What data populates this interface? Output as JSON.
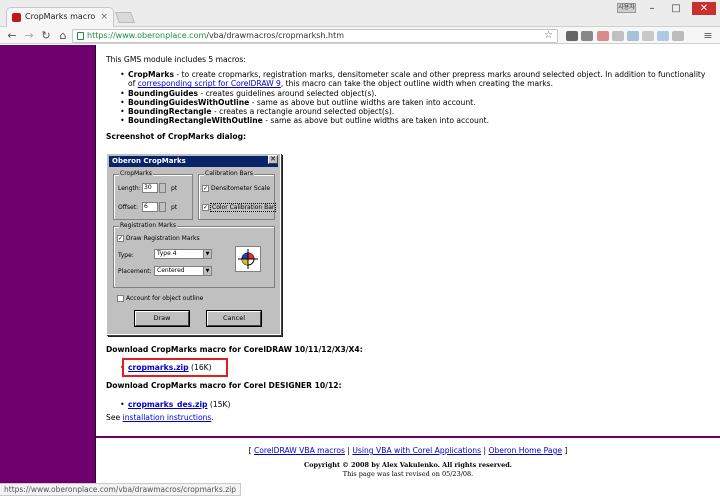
{
  "browser": {
    "tab_title": "CropMarks macro",
    "tab_close": "×",
    "url_host": "https://www.oberonplace.com",
    "url_path": "/vba/drawmacros/cropmarksh.htm",
    "back_icon": "back-arrow-icon",
    "forward_icon": "forward-arrow-icon",
    "reload_icon": "reload-icon",
    "home_icon": "home-icon",
    "user_label": "사용자",
    "window_controls": {
      "minimize": "–",
      "maximize": "□",
      "close": "✕"
    },
    "star": "☆"
  },
  "page": {
    "intro": "This GMS module includes 5 macros:",
    "macros": [
      {
        "name": "CropMarks",
        "text_a": " - to create cropmarks, registration marks, densitometer scale and other prepress marks around selected object. In addition to functionality of ",
        "link": "corresponding script for CorelDRAW 9",
        "text_b": ", this macro can take the object outline width when creating the marks."
      },
      {
        "name": "BoundingGuides",
        "text": " - creates guidelines around selected object(s)."
      },
      {
        "name": "BoundingGuidesWithOutline",
        "text": " - same as above but outline widths are taken into account."
      },
      {
        "name": "BoundingRectangle",
        "text": " - creates a rectangle around selected object(s)."
      },
      {
        "name": "BoundingRectangleWithOutline",
        "text": " - same as above but outline widths are taken into account."
      }
    ],
    "screenshot_heading": "Screenshot of CropMarks dialog:",
    "download1_heading": "Download CropMarks macro for CorelDRAW 10/11/12/X3/X4:",
    "download1_link": "cropmarks.zip",
    "download1_size": "(16K)",
    "download2_heading": "Download CropMarks macro for Corel DESIGNER 10/12:",
    "download2_link": "cropmarks_des.zip",
    "download2_size": "(15K)",
    "see": "See ",
    "install_link": "installation instructions",
    "see_end": ".",
    "footer_links": [
      "CorelDRAW VBA macros",
      "Using VBA with Corel Applications",
      "Oberon Home Page"
    ],
    "footer_sep": "|",
    "footer_open": "[",
    "footer_close": "]",
    "copyright": "Copyright © 2008 by Alex Vakulenko. All rights reserved.",
    "revised": "This page was last revised on 05/23/08."
  },
  "dialog": {
    "title": "Oberon CropMarks",
    "close": "✕",
    "cropmarks_group": "CropMarks",
    "length_label": "Length:",
    "length_value": "30",
    "offset_label": "Offset:",
    "offset_value": "6",
    "unit": "pt",
    "calibration_group": "Calibration Bars",
    "densitometer_label": "Densitometer Scale",
    "color_bar_label": "Color Calibration Bar",
    "registration_group": "Registration Marks",
    "draw_reg_label": "Draw Registration Marks",
    "type_label": "Type:",
    "type_value": "Type 4",
    "placement_label": "Placement:",
    "placement_value": "Centered",
    "account_label": "Account for object outline",
    "draw_button": "Draw",
    "cancel_button": "Cancel",
    "check": "✓",
    "spin_up": "▲",
    "spin_down": "▼",
    "dropdown": "▼"
  },
  "status_bar": {
    "text": "https://www.oberonplace.com/vba/drawmacros/cropmarks.zip"
  },
  "colors": {
    "sidebar": "#6e006e",
    "link": "#0000cc",
    "highlight": "#e02020"
  }
}
